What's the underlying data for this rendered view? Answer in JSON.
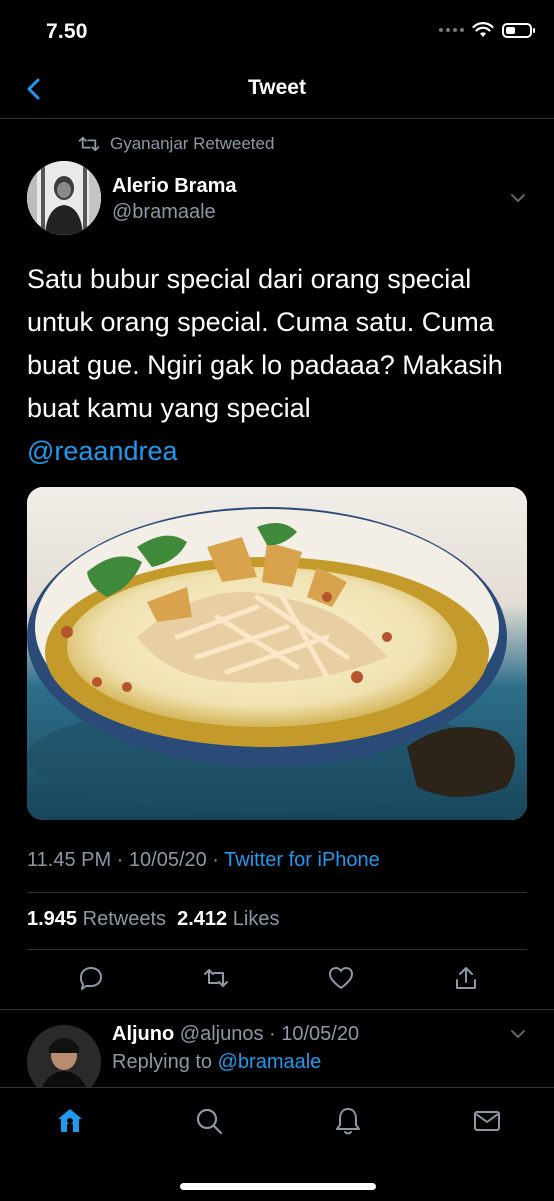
{
  "status_bar": {
    "time": "7.50"
  },
  "nav": {
    "title": "Tweet"
  },
  "retweet": {
    "label": "Gyananjar Retweeted"
  },
  "tweet": {
    "author_name": "Alerio Brama",
    "author_handle": "@bramaale",
    "text": "Satu bubur special dari orang special untuk orang special. Cuma satu. Cuma buat gue. Ngiri gak lo padaaa? Makasih buat kamu yang special",
    "mention": "@reaandrea",
    "time_date": "11.45 PM · 10/05/20 · ",
    "source": "Twitter for iPhone",
    "retweets_count": "1.945",
    "retweets_label": "Retweets",
    "likes_count": "2.412",
    "likes_label": "Likes"
  },
  "reply": {
    "name": "Aljuno",
    "handle_date": " @aljunos · 10/05/20",
    "replying_prefix": "Replying to ",
    "replying_handle": "@bramaale"
  },
  "icons": {
    "back": "chevron-left-icon",
    "retweet": "retweet-icon",
    "caret": "chevron-down-icon",
    "reply": "comment-icon",
    "like": "heart-icon",
    "share": "share-icon",
    "home": "home-icon",
    "search": "search-icon",
    "notifications": "bell-icon",
    "messages": "mail-icon"
  },
  "colors": {
    "accent": "#1d9bf0",
    "secondary_text": "#8b98a5",
    "background": "#000000"
  }
}
